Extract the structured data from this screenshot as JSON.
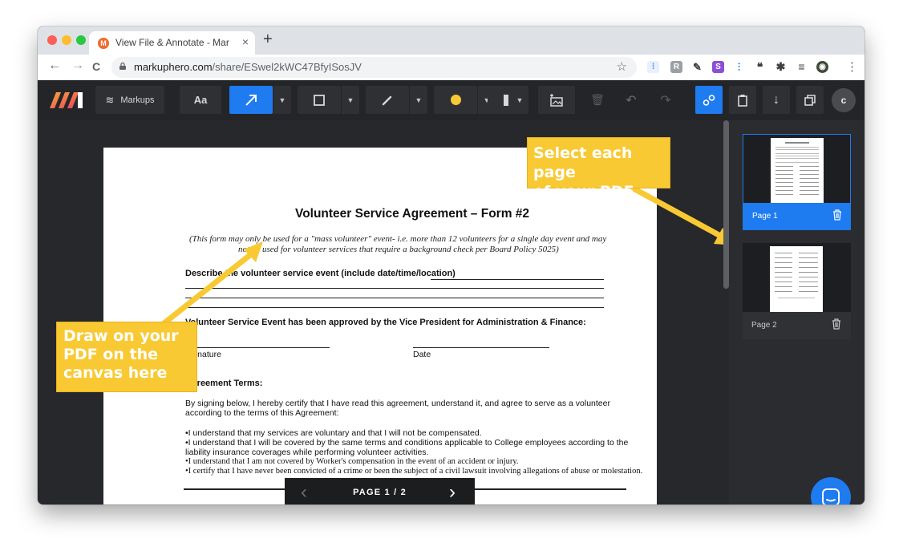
{
  "browser": {
    "tab_title": "View File & Annotate - Markup",
    "tab_close": "×",
    "new_tab": "+",
    "url_host": "markuphero.com",
    "url_path": "/share/ESwel2kWC47BfyISosJV",
    "nav_back": "←",
    "nav_forward": "→",
    "nav_reload": "C",
    "bookmark_star": "☆",
    "menu": "⋮",
    "extensions": [
      {
        "icon": "analytics-extension-icon",
        "glyph": "⁞",
        "color": "#4285f4"
      },
      {
        "icon": "reader-extension-icon",
        "glyph": "R",
        "color": "#8e8e8e"
      },
      {
        "icon": "eyedropper-extension-icon",
        "glyph": "✎",
        "color": "#5f6368"
      },
      {
        "icon": "s-extension-icon",
        "glyph": "S",
        "color": "#8c4fd6"
      },
      {
        "icon": "bars-extension-icon",
        "glyph": "Ⅰ",
        "color": "#1a73e8"
      },
      {
        "icon": "quote-extension-icon",
        "glyph": "❝",
        "color": "#3c4043"
      },
      {
        "icon": "puzzle-extension-icon",
        "glyph": "✱",
        "color": "#3c4043"
      },
      {
        "icon": "playlist-extension-icon",
        "glyph": "≡",
        "color": "#3c4043"
      }
    ],
    "avatar": "◉"
  },
  "toolbar": {
    "logo": "M",
    "markups_label": "Markups",
    "text_tool_label": "Aa",
    "account_initial": "c",
    "accent_color": "#1e7bf0",
    "highlight_color": "#f9c933"
  },
  "document": {
    "title": "Volunteer Service Agreement – Form #2",
    "intro_line1": "(This form may only be used for a \"mass volunteer\" event- i.e. more than 12 volunteers for a single day event and may",
    "intro_line2": "not be used for volunteer services that require a background check per Board Policy 5025)",
    "describe_label": "Describe the volunteer service event (include date/time/location)",
    "approved_label": "Volunteer Service Event has been approved by the Vice President for Administration & Finance:",
    "signature_label": "Signature",
    "date_label": "Date",
    "terms_label": "Agreement Terms:",
    "terms_intro_line1": "By signing below, I hereby certify that I have read this agreement, understand it, and agree to serve as a volunteer",
    "terms_intro_line2": "according to the terms of this Agreement:",
    "bullet1": "•I understand that my services are voluntary and that I will not be compensated.",
    "bullet2_line1": "•I understand that I will be covered by the same terms and conditions applicable to College employees according to the",
    "bullet2_line2": "liability insurance coverages while performing volunteer activities.",
    "bullet3": "•I understand that I am not covered by Worker's compensation in the event of an accident or injury.",
    "bullet4": "•I certify that I have never been convicted of a crime or been the subject of a civil lawsuit involving allegations of abuse or molestation."
  },
  "callouts": {
    "draw_line1": "Draw on your",
    "draw_line2": "PDF on the",
    "draw_line3": "canvas here",
    "select_line1": "Select each page",
    "select_line2": "of your PDF here"
  },
  "pager": {
    "label": "PAGE 1 / 2",
    "prev": "‹",
    "next": "›"
  },
  "pages": [
    {
      "label": "Page 1",
      "selected": true
    },
    {
      "label": "Page 2",
      "selected": false
    }
  ]
}
